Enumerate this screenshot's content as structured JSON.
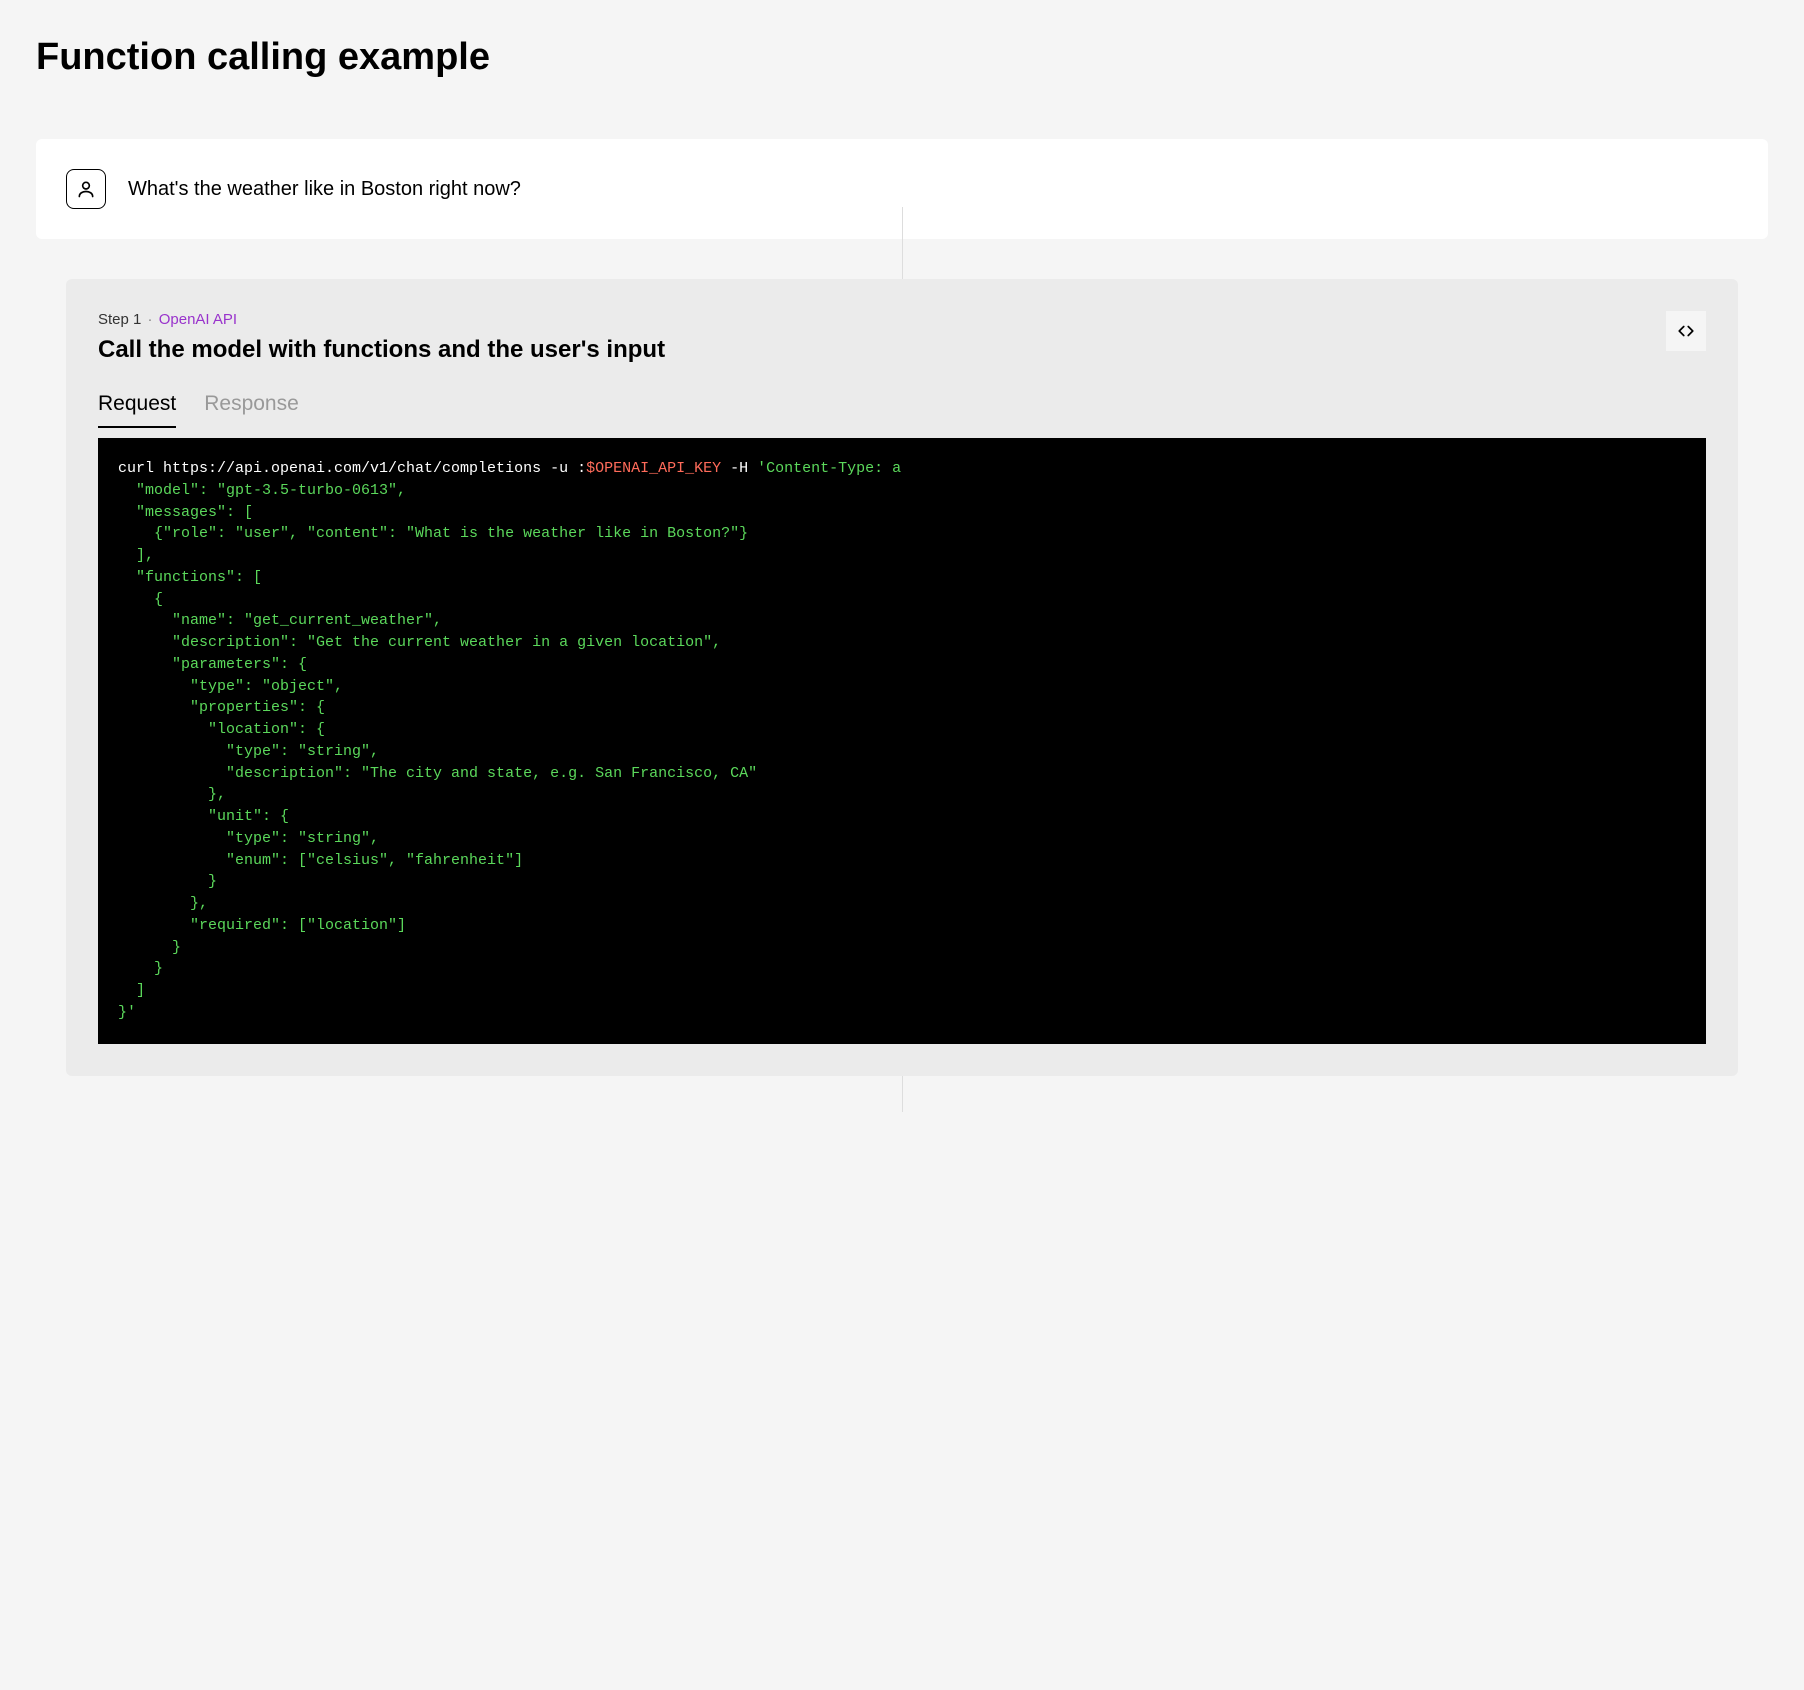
{
  "page": {
    "title": "Function calling example"
  },
  "user": {
    "message": "What's the weather like in Boston right now?"
  },
  "step": {
    "number": "Step 1",
    "dot": "·",
    "api_label": "OpenAI API",
    "title": "Call the model with functions and the user's input"
  },
  "tabs": {
    "request": "Request",
    "response": "Response"
  },
  "code": {
    "line01_prefix": "curl https://api.openai.com/v1/chat/completions -u :",
    "line01_key": "$OPENAI_API_KEY",
    "line01_mid": " -H ",
    "line01_suffix": "'Content-Type: a",
    "line02": "  \"model\": \"gpt-3.5-turbo-0613\",",
    "line03": "  \"messages\": [",
    "line04": "    {\"role\": \"user\", \"content\": \"What is the weather like in Boston?\"}",
    "line05": "  ],",
    "line06": "  \"functions\": [",
    "line07": "    {",
    "line08": "      \"name\": \"get_current_weather\",",
    "line09": "      \"description\": \"Get the current weather in a given location\",",
    "line10": "      \"parameters\": {",
    "line11": "        \"type\": \"object\",",
    "line12": "        \"properties\": {",
    "line13": "          \"location\": {",
    "line14": "            \"type\": \"string\",",
    "line15": "            \"description\": \"The city and state, e.g. San Francisco, CA\"",
    "line16": "          },",
    "line17": "          \"unit\": {",
    "line18": "            \"type\": \"string\",",
    "line19": "            \"enum\": [\"celsius\", \"fahrenheit\"]",
    "line20": "          }",
    "line21": "        },",
    "line22": "        \"required\": [\"location\"]",
    "line23": "      }",
    "line24": "    }",
    "line25": "  ]",
    "line26": "}'"
  }
}
